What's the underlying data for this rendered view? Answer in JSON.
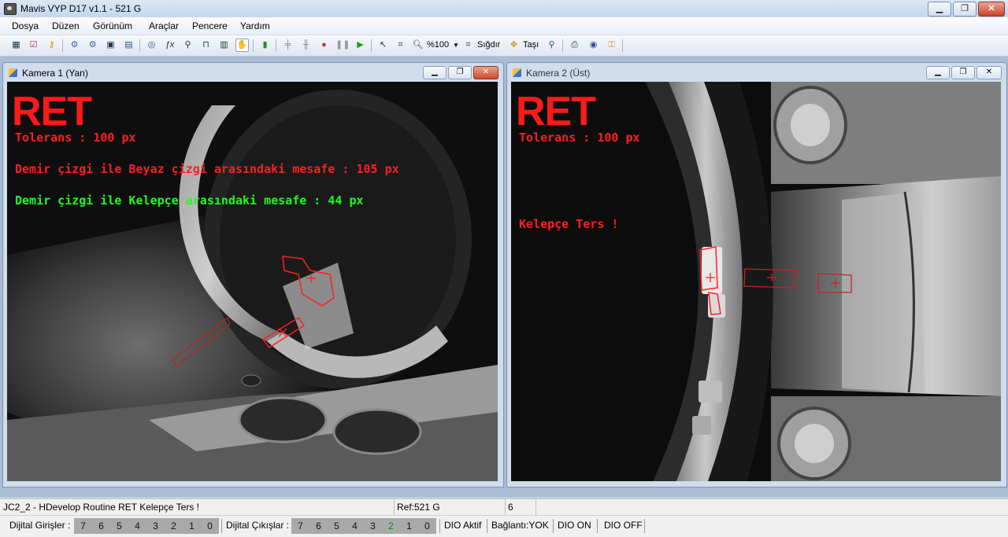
{
  "window": {
    "title": "Mavis VYP D17 v1.1 - 521 G"
  },
  "menu": [
    "Dosya",
    "Düzen",
    "Görünüm",
    "Araçlar",
    "Pencere",
    "Yardım"
  ],
  "toolbar": {
    "zoom_label": "%100",
    "fit_label": "Sığdır",
    "move_label": "Taşı"
  },
  "camera1": {
    "title": "Kamera 1 (Yan)",
    "result": "RET",
    "tolerance": "Tolerans : 100 px",
    "line1": "Demir çizgi ile Beyaz çizgi arasındaki mesafe : 105 px",
    "line2": "Demir çizgi ile Kelepçe arasındaki mesafe : 44 px"
  },
  "camera2": {
    "title": "Kamera 2 (Üst)",
    "result": "RET",
    "tolerance": "Tolerans : 100 px",
    "message": "Kelepçe Ters !"
  },
  "status": {
    "routine": "JC2_2 - HDevelop Routine RET Kelepçe Ters !",
    "ref": "Ref:521 G",
    "count": "6"
  },
  "io": {
    "inputs_label": "Dijital Girişler :",
    "inputs_bits": [
      "7",
      "6",
      "5",
      "4",
      "3",
      "2",
      "1",
      "0"
    ],
    "outputs_label": "Dijital Çıkışlar :",
    "outputs_bits": [
      "7",
      "6",
      "5",
      "4",
      "3",
      "2",
      "1",
      "0"
    ],
    "outputs_active_index": 5,
    "dio_active": "DIO Aktif",
    "connection": "Bağlantı:YOK",
    "dio_on": "DIO ON",
    "dio_off": "DIO OFF"
  },
  "colors": {
    "overlay_red": "#ff1f1f",
    "overlay_green": "#19ff19"
  }
}
